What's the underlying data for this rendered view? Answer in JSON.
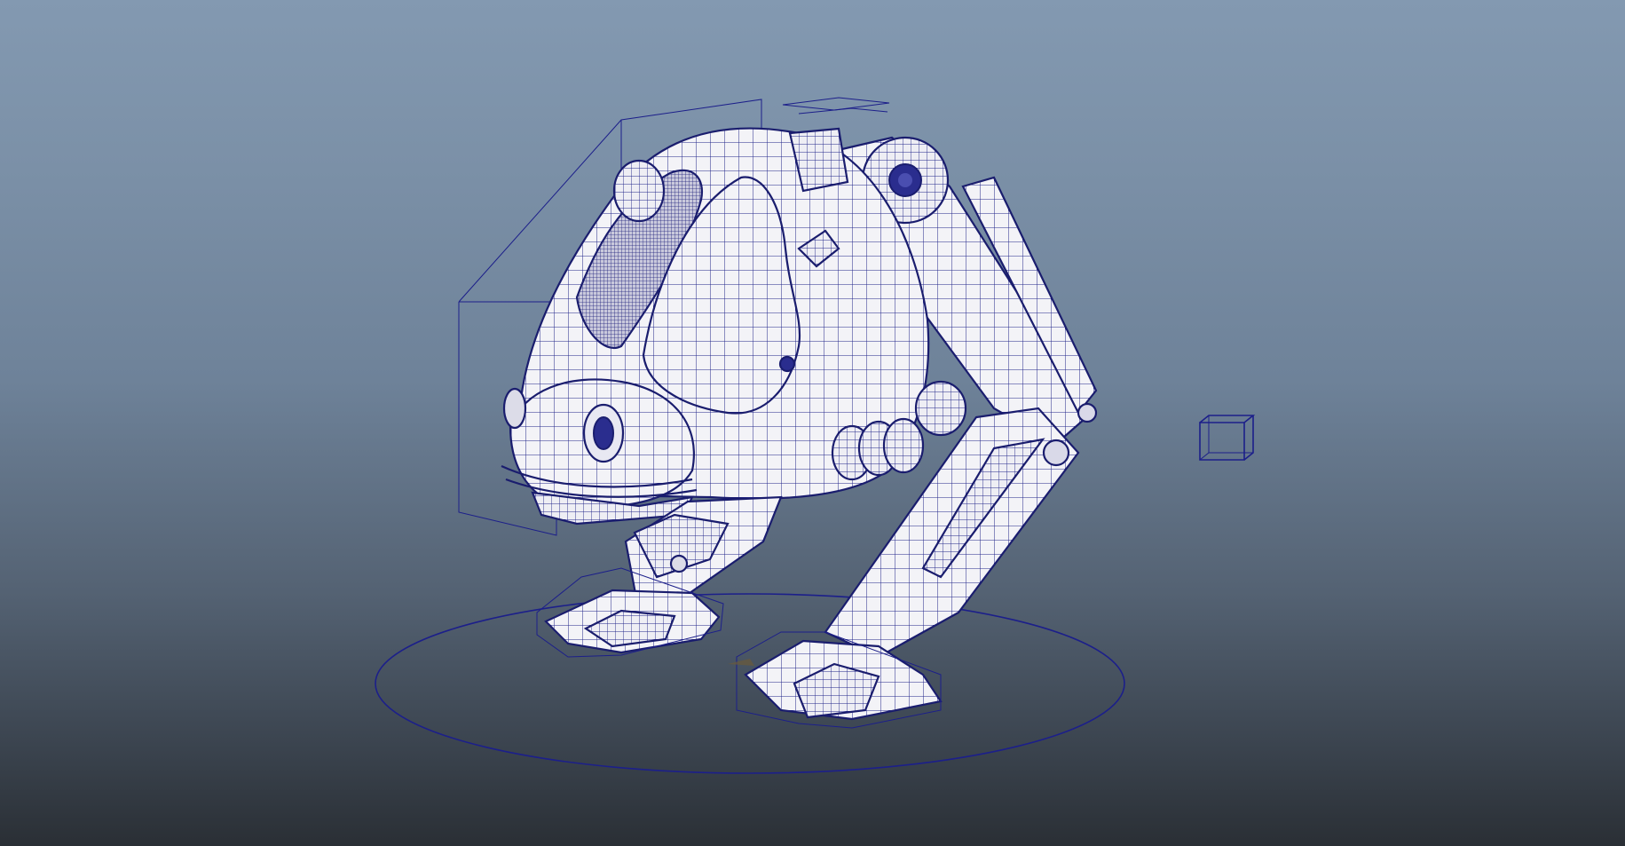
{
  "viewport": {
    "background_top": "#8399b1",
    "background_bottom": "#2a2f35",
    "wireframe_color": "#1c1f8a",
    "surface_color": "#f2f2f6"
  },
  "scene": {
    "display_mode": "wireframe-on-shaded",
    "objects": [
      "robot-body-mesh",
      "robot-left-leg-mesh",
      "robot-right-leg-mesh",
      "root-control-circle",
      "foot-controls",
      "locator-cube"
    ]
  }
}
